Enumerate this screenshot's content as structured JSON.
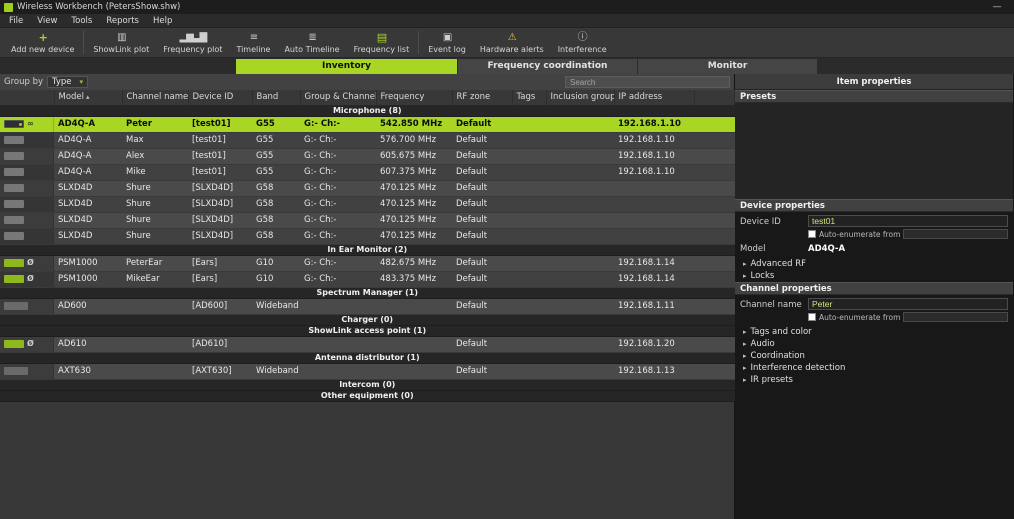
{
  "window": {
    "title": "Wireless Workbench (PetersShow.shw)",
    "minimize_label": "—"
  },
  "menu": [
    "File",
    "View",
    "Tools",
    "Reports",
    "Help"
  ],
  "toolbar": [
    {
      "label": "Add new device",
      "icon": "add-device-icon",
      "divider_after": true
    },
    {
      "label": "ShowLink plot",
      "icon": "showlink-plot-icon"
    },
    {
      "label": "Frequency plot",
      "icon": "frequency-plot-icon"
    },
    {
      "label": "Timeline",
      "icon": "timeline-icon"
    },
    {
      "label": "Auto Timeline",
      "icon": "auto-timeline-icon"
    },
    {
      "label": "Frequency list",
      "icon": "frequency-list-icon",
      "divider_after": true
    },
    {
      "label": "Event log",
      "icon": "event-log-icon"
    },
    {
      "label": "Hardware alerts",
      "icon": "hardware-alerts-icon"
    },
    {
      "label": "Interference",
      "icon": "interference-icon"
    }
  ],
  "tabs": [
    {
      "label": "Inventory",
      "active": true
    },
    {
      "label": "Frequency coordination",
      "active": false
    },
    {
      "label": "Monitor",
      "active": false
    }
  ],
  "filter": {
    "group_by_label": "Group by",
    "group_by_value": "Type",
    "search_placeholder": "Search"
  },
  "inventory": {
    "columns": [
      "",
      "Model",
      "Channel name",
      "Device ID",
      "Band",
      "Group & Channel",
      "Frequency",
      "RF zone",
      "Tags",
      "Inclusion group",
      "IP address"
    ],
    "sorted_column": "Model",
    "sections": [
      {
        "title": "Microphone (8)",
        "rows": [
          {
            "cells": [
              "AD4Q-A",
              "Peter",
              "[test01]",
              "G55",
              "G:- Ch:-",
              "542.850 MHz",
              "Default",
              "",
              "",
              "192.168.1.10"
            ],
            "selected": true,
            "device_icon": "dark",
            "badge": "link"
          },
          {
            "cells": [
              "AD4Q-A",
              "Max",
              "[test01]",
              "G55",
              "G:- Ch:-",
              "576.700 MHz",
              "Default",
              "",
              "",
              "192.168.1.10"
            ],
            "device_icon": "plain"
          },
          {
            "cells": [
              "AD4Q-A",
              "Alex",
              "[test01]",
              "G55",
              "G:- Ch:-",
              "605.675 MHz",
              "Default",
              "",
              "",
              "192.168.1.10"
            ],
            "device_icon": "plain"
          },
          {
            "cells": [
              "AD4Q-A",
              "Mike",
              "[test01]",
              "G55",
              "G:- Ch:-",
              "607.375 MHz",
              "Default",
              "",
              "",
              "192.168.1.10"
            ],
            "device_icon": "plain"
          },
          {
            "cells": [
              "SLXD4D",
              "Shure",
              "[SLXD4D]",
              "G58",
              "G:- Ch:-",
              "470.125 MHz",
              "Default",
              "",
              "",
              ""
            ],
            "device_icon": "plain"
          },
          {
            "cells": [
              "SLXD4D",
              "Shure",
              "[SLXD4D]",
              "G58",
              "G:- Ch:-",
              "470.125 MHz",
              "Default",
              "",
              "",
              ""
            ],
            "device_icon": "plain"
          },
          {
            "cells": [
              "SLXD4D",
              "Shure",
              "[SLXD4D]",
              "G58",
              "G:- Ch:-",
              "470.125 MHz",
              "Default",
              "",
              "",
              ""
            ],
            "device_icon": "plain"
          },
          {
            "cells": [
              "SLXD4D",
              "Shure",
              "[SLXD4D]",
              "G58",
              "G:- Ch:-",
              "470.125 MHz",
              "Default",
              "",
              "",
              ""
            ],
            "device_icon": "plain"
          }
        ]
      },
      {
        "title": "In Ear Monitor (2)",
        "rows": [
          {
            "cells": [
              "PSM1000",
              "PeterEar",
              "[Ears]",
              "G10",
              "G:- Ch:-",
              "482.675 MHz",
              "Default",
              "",
              "",
              "192.168.1.14"
            ],
            "device_icon": "green",
            "badge": "slash"
          },
          {
            "cells": [
              "PSM1000",
              "MikeEar",
              "[Ears]",
              "G10",
              "G:- Ch:-",
              "483.375 MHz",
              "Default",
              "",
              "",
              "192.168.1.14"
            ],
            "device_icon": "green",
            "badge": "slash"
          }
        ]
      },
      {
        "title": "Spectrum Manager (1)",
        "rows": [
          {
            "cells": [
              "AD600",
              "",
              "[AD600]",
              "Wideband",
              "",
              "",
              "Default",
              "",
              "",
              "192.168.1.11"
            ],
            "device_icon": "wide"
          }
        ]
      },
      {
        "title": "Charger (0)",
        "rows": []
      },
      {
        "title": "ShowLink access point (1)",
        "rows": [
          {
            "cells": [
              "AD610",
              "",
              "[AD610]",
              "",
              "",
              "",
              "Default",
              "",
              "",
              "192.168.1.20"
            ],
            "device_icon": "green",
            "badge": "slash"
          }
        ]
      },
      {
        "title": "Antenna distributor (1)",
        "rows": [
          {
            "cells": [
              "AXT630",
              "",
              "[AXT630]",
              "Wideband",
              "",
              "",
              "Default",
              "",
              "",
              "192.168.1.13"
            ],
            "device_icon": "wide"
          }
        ]
      },
      {
        "title": "Intercom (0)",
        "rows": []
      },
      {
        "title": "Other equipment (0)",
        "rows": []
      }
    ]
  },
  "properties": {
    "header": "Item properties",
    "presets_header": "Presets",
    "device": {
      "header": "Device properties",
      "device_id_label": "Device ID",
      "device_id_value": "test01",
      "auto_enum_label": "Auto-enumerate from",
      "model_label": "Model",
      "model_value": "AD4Q-A",
      "expanders": [
        "Advanced RF",
        "Locks"
      ]
    },
    "channel": {
      "header": "Channel properties",
      "name_label": "Channel name",
      "name_value": "Peter",
      "auto_enum_label": "Auto-enumerate from",
      "expanders": [
        "Tags and color",
        "Audio",
        "Coordination",
        "Interference detection",
        "IR presets"
      ]
    }
  },
  "colors": {
    "accent": "#a9d525",
    "row": "#4a4a4a",
    "panel": "#181818"
  }
}
